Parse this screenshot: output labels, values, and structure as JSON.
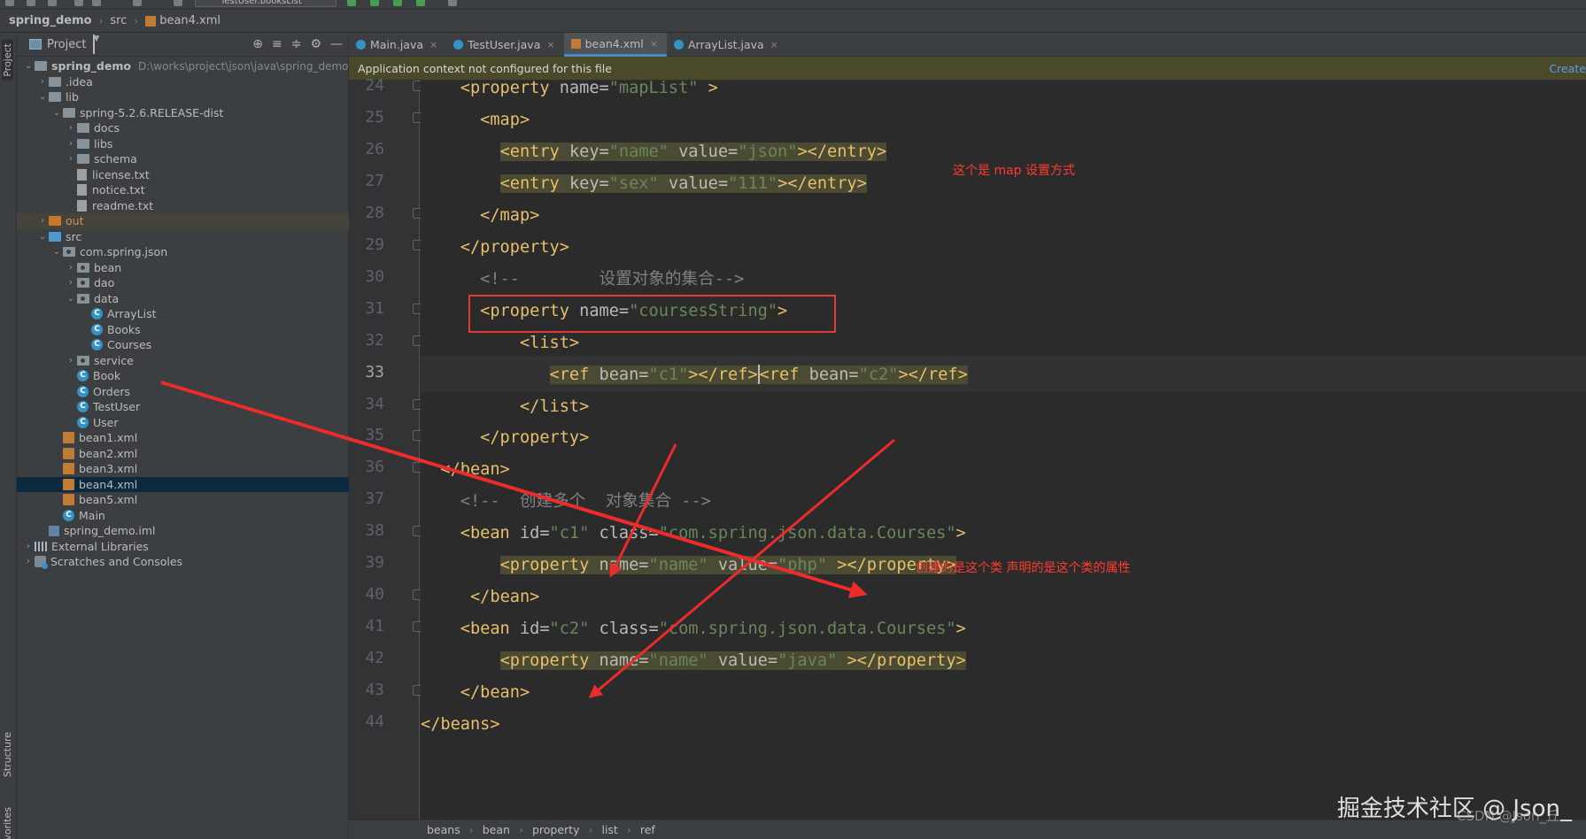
{
  "toolbar": {
    "run_config": "TestUser.booksList"
  },
  "navbar": {
    "project": "spring_demo",
    "folder": "src",
    "file": "bean4.xml"
  },
  "left_stripe": {
    "project": "Project",
    "structure": "Structure",
    "favorites": "Favorites"
  },
  "project_panel": {
    "title": "Project",
    "tree": [
      {
        "label": "spring_demo",
        "path": "D:\\works\\project\\json\\java\\spring_demo",
        "depth": 0,
        "chev": "down",
        "icon": "folder",
        "bold": true
      },
      {
        "label": ".idea",
        "depth": 1,
        "chev": "right",
        "icon": "folder"
      },
      {
        "label": "lib",
        "depth": 1,
        "chev": "down",
        "icon": "folder"
      },
      {
        "label": "spring-5.2.6.RELEASE-dist",
        "depth": 2,
        "chev": "down",
        "icon": "folder"
      },
      {
        "label": "docs",
        "depth": 3,
        "chev": "right",
        "icon": "folder"
      },
      {
        "label": "libs",
        "depth": 3,
        "chev": "right",
        "icon": "folder"
      },
      {
        "label": "schema",
        "depth": 3,
        "chev": "right",
        "icon": "folder"
      },
      {
        "label": "license.txt",
        "depth": 3,
        "chev": "none",
        "icon": "file"
      },
      {
        "label": "notice.txt",
        "depth": 3,
        "chev": "none",
        "icon": "file"
      },
      {
        "label": "readme.txt",
        "depth": 3,
        "chev": "none",
        "icon": "file"
      },
      {
        "label": "out",
        "depth": 1,
        "chev": "right",
        "icon": "folder-orange",
        "excluded": true
      },
      {
        "label": "src",
        "depth": 1,
        "chev": "down",
        "icon": "folder-blue"
      },
      {
        "label": "com.spring.json",
        "depth": 2,
        "chev": "down",
        "icon": "package"
      },
      {
        "label": "bean",
        "depth": 3,
        "chev": "right",
        "icon": "package"
      },
      {
        "label": "dao",
        "depth": 3,
        "chev": "right",
        "icon": "package"
      },
      {
        "label": "data",
        "depth": 3,
        "chev": "down",
        "icon": "package"
      },
      {
        "label": "ArrayList",
        "depth": 4,
        "chev": "none",
        "icon": "class"
      },
      {
        "label": "Books",
        "depth": 4,
        "chev": "none",
        "icon": "class"
      },
      {
        "label": "Courses",
        "depth": 4,
        "chev": "none",
        "icon": "class"
      },
      {
        "label": "service",
        "depth": 3,
        "chev": "right",
        "icon": "package"
      },
      {
        "label": "Book",
        "depth": 3,
        "chev": "none",
        "icon": "class"
      },
      {
        "label": "Orders",
        "depth": 3,
        "chev": "none",
        "icon": "class"
      },
      {
        "label": "TestUser",
        "depth": 3,
        "chev": "none",
        "icon": "class"
      },
      {
        "label": "User",
        "depth": 3,
        "chev": "none",
        "icon": "class"
      },
      {
        "label": "bean1.xml",
        "depth": 2,
        "chev": "none",
        "icon": "xml"
      },
      {
        "label": "bean2.xml",
        "depth": 2,
        "chev": "none",
        "icon": "xml"
      },
      {
        "label": "bean3.xml",
        "depth": 2,
        "chev": "none",
        "icon": "xml"
      },
      {
        "label": "bean4.xml",
        "depth": 2,
        "chev": "none",
        "icon": "xml",
        "selected": true
      },
      {
        "label": "bean5.xml",
        "depth": 2,
        "chev": "none",
        "icon": "xml"
      },
      {
        "label": "Main",
        "depth": 2,
        "chev": "none",
        "icon": "class"
      },
      {
        "label": "spring_demo.iml",
        "depth": 1,
        "chev": "none",
        "icon": "iml"
      },
      {
        "label": "External Libraries",
        "depth": 0,
        "chev": "right",
        "icon": "extlib"
      },
      {
        "label": "Scratches and Consoles",
        "depth": 0,
        "chev": "right",
        "icon": "scratch"
      }
    ]
  },
  "tabs": [
    {
      "label": "Main.java",
      "icon": "class",
      "active": false
    },
    {
      "label": "TestUser.java",
      "icon": "class",
      "active": false
    },
    {
      "label": "bean4.xml",
      "icon": "xml",
      "active": true
    },
    {
      "label": "ArrayList.java",
      "icon": "class",
      "active": false
    }
  ],
  "notification": {
    "message": "Application context not configured for this file",
    "action": "Create"
  },
  "editor": {
    "current_line": 33,
    "lines": [
      {
        "n": 24,
        "fold": true,
        "parts": [
          [
            "i",
            "    "
          ],
          [
            "t",
            "<property "
          ],
          [
            "a",
            "name="
          ],
          [
            "v",
            "\"mapList\""
          ],
          [
            "a",
            " "
          ],
          [
            "t",
            ">"
          ]
        ]
      },
      {
        "n": 25,
        "fold": true,
        "parts": [
          [
            "i",
            "      "
          ],
          [
            "t",
            "<map>"
          ]
        ]
      },
      {
        "n": 26,
        "fold": false,
        "parts": [
          [
            "i",
            "        "
          ],
          [
            "ht",
            "<entry "
          ],
          [
            "ha",
            "key="
          ],
          [
            "hv",
            "\"name\""
          ],
          [
            "ha",
            " value="
          ],
          [
            "hv",
            "\"json\""
          ],
          [
            "ht",
            "></entry>"
          ]
        ]
      },
      {
        "n": 27,
        "fold": false,
        "parts": [
          [
            "i",
            "        "
          ],
          [
            "ht",
            "<entry "
          ],
          [
            "ha",
            "key="
          ],
          [
            "hv",
            "\"sex\""
          ],
          [
            "ha",
            " value="
          ],
          [
            "hv",
            "\"111\""
          ],
          [
            "ht",
            "></entry>"
          ]
        ]
      },
      {
        "n": 28,
        "fold": true,
        "parts": [
          [
            "i",
            "      "
          ],
          [
            "t",
            "</map>"
          ]
        ]
      },
      {
        "n": 29,
        "fold": true,
        "parts": [
          [
            "i",
            "    "
          ],
          [
            "t",
            "</property>"
          ]
        ]
      },
      {
        "n": 30,
        "fold": false,
        "parts": [
          [
            "i",
            "      "
          ],
          [
            "c",
            "<!--        设置对象的集合-->"
          ]
        ]
      },
      {
        "n": 31,
        "fold": true,
        "parts": [
          [
            "i",
            "      "
          ],
          [
            "t",
            "<property "
          ],
          [
            "a",
            "name="
          ],
          [
            "v",
            "\"coursesString\""
          ],
          [
            "t",
            ">"
          ]
        ]
      },
      {
        "n": 32,
        "fold": true,
        "parts": [
          [
            "i",
            "          "
          ],
          [
            "t",
            "<list>"
          ]
        ]
      },
      {
        "n": 33,
        "fold": false,
        "parts": [
          [
            "i",
            "             "
          ],
          [
            "ht",
            "<ref "
          ],
          [
            "ha",
            "bean="
          ],
          [
            "hv",
            "\"c1\""
          ],
          [
            "ht",
            "></ref>"
          ],
          [
            "caret",
            ""
          ],
          [
            "ht",
            "<ref "
          ],
          [
            "ha",
            "bean="
          ],
          [
            "hv",
            "\"c2\""
          ],
          [
            "ht",
            "></ref>"
          ]
        ]
      },
      {
        "n": 34,
        "fold": true,
        "parts": [
          [
            "i",
            "          "
          ],
          [
            "t",
            "</list>"
          ]
        ]
      },
      {
        "n": 35,
        "fold": true,
        "parts": [
          [
            "i",
            "      "
          ],
          [
            "t",
            "</property>"
          ]
        ]
      },
      {
        "n": 36,
        "fold": true,
        "parts": [
          [
            "i",
            "  "
          ],
          [
            "t",
            "</bean>"
          ]
        ]
      },
      {
        "n": 37,
        "fold": false,
        "parts": [
          [
            "i",
            "    "
          ],
          [
            "c",
            "<!--  创建多个  对象集合 -->"
          ]
        ]
      },
      {
        "n": 38,
        "fold": true,
        "parts": [
          [
            "i",
            "    "
          ],
          [
            "t",
            "<bean "
          ],
          [
            "a",
            "id="
          ],
          [
            "v",
            "\"c1\""
          ],
          [
            "a",
            " class="
          ],
          [
            "v",
            "\"com.spring.json.data.Courses\""
          ],
          [
            "t",
            ">"
          ]
        ]
      },
      {
        "n": 39,
        "fold": false,
        "parts": [
          [
            "i",
            "        "
          ],
          [
            "ht",
            "<property "
          ],
          [
            "ha",
            "name="
          ],
          [
            "hv",
            "\"name\""
          ],
          [
            "ha",
            " value="
          ],
          [
            "hv",
            "\"php\""
          ],
          [
            "ht",
            " ></property>"
          ]
        ]
      },
      {
        "n": 40,
        "fold": true,
        "parts": [
          [
            "i",
            "     "
          ],
          [
            "t",
            "</bean>"
          ]
        ]
      },
      {
        "n": 41,
        "fold": true,
        "parts": [
          [
            "i",
            "    "
          ],
          [
            "t",
            "<bean "
          ],
          [
            "a",
            "id="
          ],
          [
            "v",
            "\"c2\""
          ],
          [
            "a",
            " class="
          ],
          [
            "v",
            "\"com.spring.json.data.Courses\""
          ],
          [
            "t",
            ">"
          ]
        ]
      },
      {
        "n": 42,
        "fold": false,
        "parts": [
          [
            "i",
            "        "
          ],
          [
            "ht",
            "<property "
          ],
          [
            "ha",
            "name="
          ],
          [
            "hv",
            "\"name\""
          ],
          [
            "ha",
            " value="
          ],
          [
            "hv",
            "\"java\""
          ],
          [
            "ht",
            " ></property>"
          ]
        ]
      },
      {
        "n": 43,
        "fold": true,
        "parts": [
          [
            "i",
            "    "
          ],
          [
            "t",
            "</bean>"
          ]
        ]
      },
      {
        "n": 44,
        "fold": false,
        "parts": [
          [
            "t",
            "</beans>"
          ]
        ]
      }
    ]
  },
  "annotations": {
    "map_note": "这个是 map 设置方式",
    "class_note": "创建的是这个类 声明的是这个类的属性"
  },
  "breadcrumbs": [
    "beans",
    "bean",
    "property",
    "list",
    "ref"
  ],
  "watermark": {
    "text": "掘金技术社区 @ Json_",
    "overlay": "CSDN @Json_丘"
  },
  "colors": {
    "annotation_red": "#e53935",
    "tag": "#e8bf6a",
    "value": "#6a8759",
    "selection": "#0d293e"
  }
}
